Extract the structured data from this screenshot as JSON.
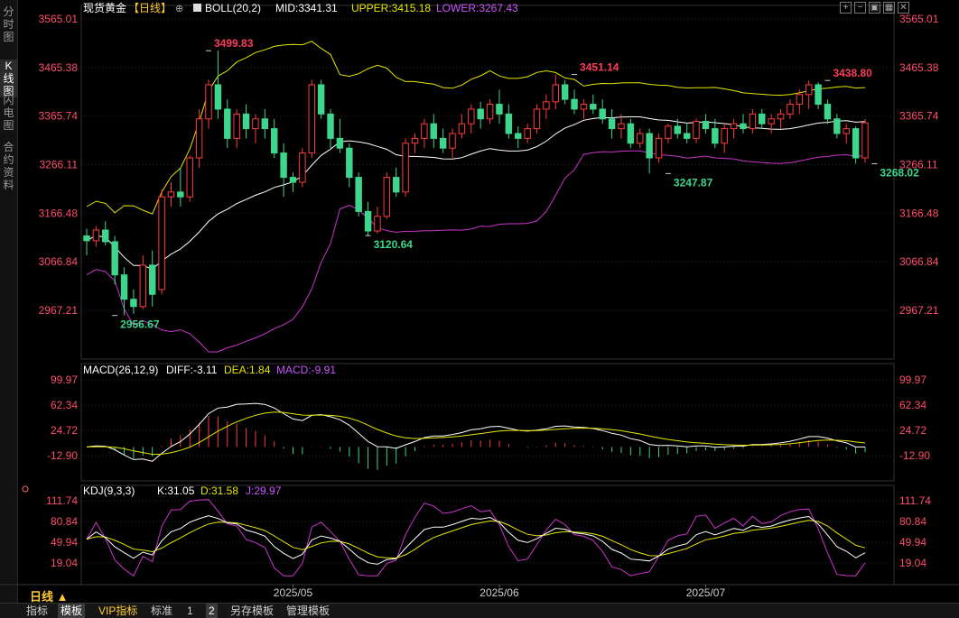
{
  "left_tabs": [
    {
      "label": "分时图",
      "active": false
    },
    {
      "label": "K线图",
      "active": true
    },
    {
      "label": "闪电图",
      "active": false
    },
    {
      "label": "合约资料",
      "active": false
    }
  ],
  "header": {
    "instrument": "现货黄金",
    "period": "【日线】",
    "boll_label": "BOLL(20,2)",
    "mid": "MID:3341.31",
    "upper": "UPPER:3415.18",
    "lower": "LOWER:3267.43"
  },
  "macd_header": {
    "label": "MACD(26,12,9)",
    "diff": "DIFF:-3.11",
    "dea": "DEA:1.84",
    "macd": "MACD:-9.91"
  },
  "kdj_header": {
    "label": "KDJ(9,3,3)",
    "k": "K:31.05",
    "d": "D:31.58",
    "j": "J:29.97"
  },
  "timeframe_label": "日线 ▲",
  "footer_tabs": [
    {
      "label": "指标",
      "active": false,
      "vip": false
    },
    {
      "label": "模板",
      "active": true,
      "vip": false
    },
    {
      "label": "VIP指标",
      "active": false,
      "vip": true
    },
    {
      "label": "标准",
      "active": false,
      "vip": false
    },
    {
      "label": "1",
      "active": false,
      "vip": false
    },
    {
      "label": "2",
      "active": true,
      "vip": false
    },
    {
      "label": "另存模板",
      "active": false,
      "vip": false
    },
    {
      "label": "管理模板",
      "active": false,
      "vip": false
    }
  ],
  "toolbar_icons": [
    "zoom-in-icon",
    "zoom-out-icon",
    "layout-icon",
    "grid-icon",
    "close-icon"
  ],
  "colors": {
    "up": "#ff3b3b",
    "down": "#3dd68c",
    "mid": "#ffffff",
    "upper": "#e6e600",
    "lower": "#cc33cc",
    "dea": "#e6e600",
    "diff": "#ffffff",
    "kline": "#ffffff",
    "dline": "#e6e600",
    "jline": "#cc33cc"
  },
  "chart_data": {
    "type": "candlestick",
    "price_axis": {
      "ticks": [
        "3565.01",
        "3465.38",
        "3365.74",
        "3266.11",
        "3166.48",
        "3066.84",
        "2967.21"
      ],
      "range": [
        2967.21,
        3565.01
      ]
    },
    "macd_axis": {
      "ticks": [
        "99.97",
        "62.34",
        "24.72",
        "-12.90"
      ],
      "range": [
        -12.9,
        99.97
      ]
    },
    "kdj_axis": {
      "ticks": [
        "111.74",
        "80.84",
        "49.94",
        "19.04"
      ],
      "range": [
        19.04,
        111.74
      ]
    },
    "x_labels": [
      {
        "label": "2025/05",
        "index": 22
      },
      {
        "label": "2025/06",
        "index": 44
      },
      {
        "label": "2025/07",
        "index": 66
      }
    ],
    "annotations": [
      {
        "text": "3499.83",
        "index": 13,
        "value": 3499.83,
        "type": "high"
      },
      {
        "text": "2956.67",
        "index": 3,
        "value": 2956.67,
        "type": "low"
      },
      {
        "text": "3120.64",
        "index": 30,
        "value": 3120.64,
        "type": "low"
      },
      {
        "text": "3451.14",
        "index": 52,
        "value": 3451.14,
        "type": "high"
      },
      {
        "text": "3247.87",
        "index": 62,
        "value": 3247.87,
        "type": "low"
      },
      {
        "text": "3438.80",
        "index": 79,
        "value": 3438.8,
        "type": "high"
      },
      {
        "text": "3268.02",
        "index": 84,
        "value": 3268.02,
        "type": "low"
      }
    ],
    "candles": [
      [
        3120,
        3135,
        3080,
        3110
      ],
      [
        3110,
        3140,
        3098,
        3132
      ],
      [
        3132,
        3150,
        3100,
        3108
      ],
      [
        3108,
        3120,
        3020,
        3040
      ],
      [
        3040,
        3055,
        2957,
        2990
      ],
      [
        2990,
        3010,
        2960,
        2975
      ],
      [
        2975,
        3080,
        2970,
        3060
      ],
      [
        3060,
        3090,
        2975,
        3000
      ],
      [
        3010,
        3215,
        3000,
        3200
      ],
      [
        3200,
        3230,
        3180,
        3210
      ],
      [
        3210,
        3260,
        3180,
        3200
      ],
      [
        3200,
        3285,
        3190,
        3280
      ],
      [
        3280,
        3380,
        3260,
        3360
      ],
      [
        3360,
        3440,
        3340,
        3430
      ],
      [
        3430,
        3500,
        3360,
        3380
      ],
      [
        3380,
        3400,
        3300,
        3320
      ],
      [
        3320,
        3380,
        3300,
        3370
      ],
      [
        3370,
        3390,
        3320,
        3340
      ],
      [
        3340,
        3370,
        3310,
        3360
      ],
      [
        3360,
        3380,
        3320,
        3340
      ],
      [
        3340,
        3360,
        3280,
        3290
      ],
      [
        3290,
        3310,
        3200,
        3240
      ],
      [
        3240,
        3250,
        3210,
        3230
      ],
      [
        3230,
        3300,
        3220,
        3290
      ],
      [
        3290,
        3440,
        3280,
        3430
      ],
      [
        3430,
        3440,
        3360,
        3370
      ],
      [
        3370,
        3380,
        3300,
        3320
      ],
      [
        3320,
        3360,
        3290,
        3300
      ],
      [
        3300,
        3310,
        3220,
        3240
      ],
      [
        3240,
        3250,
        3160,
        3170
      ],
      [
        3170,
        3190,
        3120,
        3130
      ],
      [
        3130,
        3180,
        3125,
        3160
      ],
      [
        3160,
        3250,
        3155,
        3240
      ],
      [
        3240,
        3260,
        3200,
        3210
      ],
      [
        3210,
        3320,
        3200,
        3310
      ],
      [
        3310,
        3330,
        3290,
        3320
      ],
      [
        3320,
        3360,
        3300,
        3350
      ],
      [
        3350,
        3370,
        3300,
        3320
      ],
      [
        3320,
        3340,
        3290,
        3300
      ],
      [
        3300,
        3340,
        3280,
        3330
      ],
      [
        3330,
        3370,
        3320,
        3350
      ],
      [
        3350,
        3390,
        3330,
        3380
      ],
      [
        3380,
        3395,
        3340,
        3360
      ],
      [
        3360,
        3400,
        3350,
        3390
      ],
      [
        3390,
        3420,
        3350,
        3370
      ],
      [
        3370,
        3390,
        3320,
        3330
      ],
      [
        3330,
        3345,
        3300,
        3320
      ],
      [
        3320,
        3350,
        3310,
        3340
      ],
      [
        3340,
        3390,
        3330,
        3380
      ],
      [
        3380,
        3410,
        3360,
        3395
      ],
      [
        3395,
        3451,
        3380,
        3430
      ],
      [
        3430,
        3440,
        3390,
        3400
      ],
      [
        3400,
        3420,
        3370,
        3380
      ],
      [
        3380,
        3400,
        3360,
        3390
      ],
      [
        3390,
        3410,
        3370,
        3380
      ],
      [
        3380,
        3400,
        3350,
        3360
      ],
      [
        3360,
        3380,
        3320,
        3340
      ],
      [
        3340,
        3370,
        3320,
        3350
      ],
      [
        3350,
        3360,
        3300,
        3310
      ],
      [
        3310,
        3340,
        3300,
        3330
      ],
      [
        3330,
        3340,
        3248,
        3280
      ],
      [
        3280,
        3330,
        3270,
        3320
      ],
      [
        3320,
        3350,
        3310,
        3345
      ],
      [
        3345,
        3360,
        3320,
        3330
      ],
      [
        3330,
        3350,
        3310,
        3320
      ],
      [
        3320,
        3360,
        3310,
        3355
      ],
      [
        3355,
        3370,
        3330,
        3340
      ],
      [
        3340,
        3360,
        3300,
        3310
      ],
      [
        3310,
        3350,
        3290,
        3340
      ],
      [
        3340,
        3360,
        3320,
        3350
      ],
      [
        3350,
        3370,
        3330,
        3340
      ],
      [
        3340,
        3380,
        3330,
        3370
      ],
      [
        3370,
        3380,
        3340,
        3350
      ],
      [
        3350,
        3370,
        3330,
        3360
      ],
      [
        3360,
        3380,
        3340,
        3370
      ],
      [
        3370,
        3400,
        3360,
        3390
      ],
      [
        3390,
        3420,
        3370,
        3410
      ],
      [
        3410,
        3439,
        3380,
        3430
      ],
      [
        3430,
        3435,
        3380,
        3390
      ],
      [
        3390,
        3400,
        3350,
        3360
      ],
      [
        3360,
        3370,
        3320,
        3330
      ],
      [
        3330,
        3350,
        3310,
        3340
      ],
      [
        3340,
        3345,
        3268,
        3280
      ],
      [
        3280,
        3360,
        3270,
        3352
      ]
    ],
    "last_visible_tag": "3268.02"
  }
}
